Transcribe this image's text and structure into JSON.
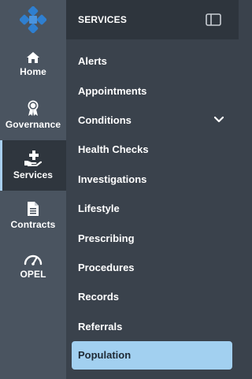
{
  "app": {
    "logo_icon": "blue-cross-logo"
  },
  "rail": {
    "items": [
      {
        "label": "Home",
        "icon": "home-icon"
      },
      {
        "label": "Governance",
        "icon": "award-ribbon-icon"
      },
      {
        "label": "Services",
        "icon": "hand-plus-icon",
        "active": true
      },
      {
        "label": "Contracts",
        "icon": "document-icon"
      },
      {
        "label": "OPEL",
        "icon": "gauge-icon"
      }
    ]
  },
  "panel": {
    "title": "SERVICES",
    "collapse_icon": "sidebar-toggle-icon",
    "items": [
      {
        "label": "Alerts"
      },
      {
        "label": "Appointments"
      },
      {
        "label": "Conditions",
        "expandable": true
      },
      {
        "label": "Health Checks"
      },
      {
        "label": "Investigations"
      },
      {
        "label": "Lifestyle"
      },
      {
        "label": "Prescribing"
      },
      {
        "label": "Procedures"
      },
      {
        "label": "Records"
      },
      {
        "label": "Referrals"
      },
      {
        "label": "Population",
        "selected": true
      }
    ]
  },
  "colors": {
    "rail_bg": "#4a5460",
    "panel_bg": "#3a424c",
    "header_bg": "#2e353d",
    "active_indicator": "#a8cfee",
    "selected_bg": "#a2d0f0",
    "logo_blue": "#2f7fd0"
  }
}
